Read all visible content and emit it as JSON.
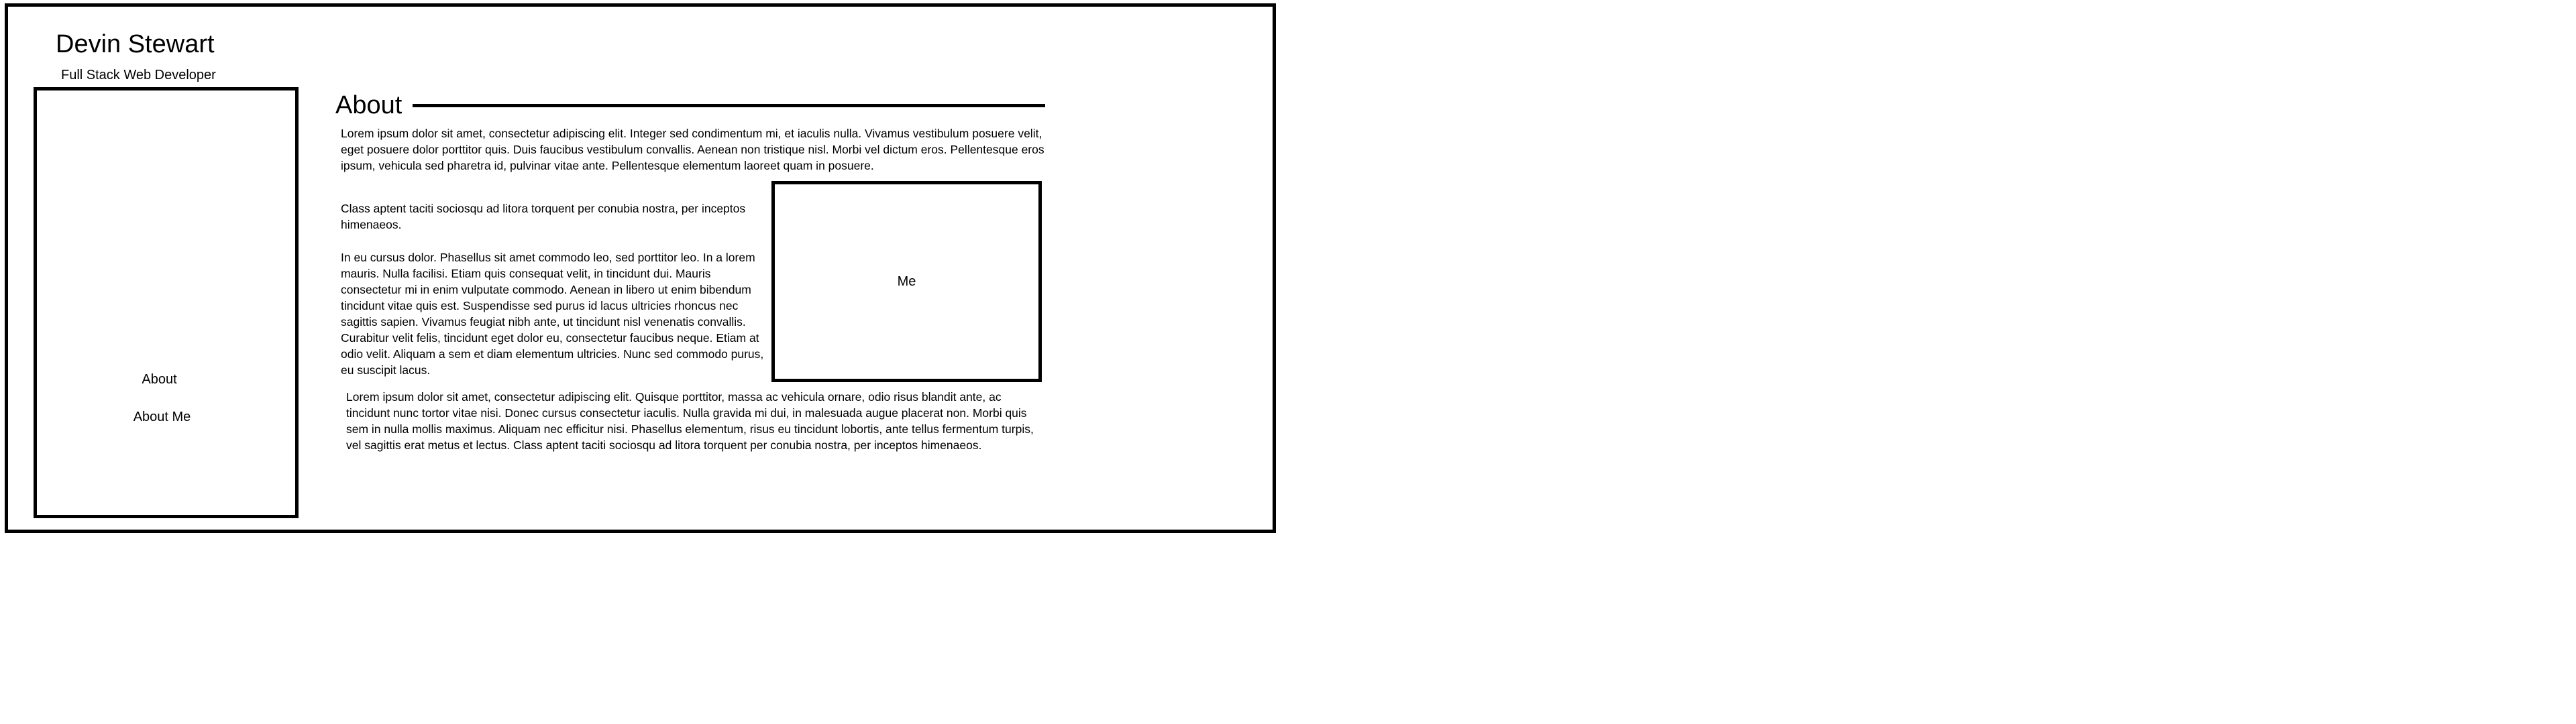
{
  "header": {
    "name": "Devin Stewart",
    "role": "Full Stack Web Developer"
  },
  "sidebar": {
    "items": [
      {
        "label": "About"
      },
      {
        "label": "About Me"
      }
    ]
  },
  "main": {
    "heading": "About",
    "paragraphs": [
      "Lorem ipsum dolor sit amet, consectetur adipiscing elit. Integer sed condimentum mi, et iaculis nulla. Vivamus vestibulum posuere velit, eget posuere dolor porttitor quis. Duis faucibus vestibulum convallis. Aenean non tristique nisl. Morbi vel dictum eros. Pellentesque eros ipsum, vehicula sed pharetra id, pulvinar vitae ante. Pellentesque elementum laoreet quam in posuere.",
      "Class aptent taciti sociosqu ad litora torquent per conubia nostra, per inceptos himenaeos.",
      "In eu cursus dolor. Phasellus sit amet commodo leo, sed porttitor leo. In a lorem mauris. Nulla facilisi. Etiam quis consequat velit, in tincidunt dui. Mauris consectetur mi in enim vulputate commodo. Aenean in libero ut enim bibendum tincidunt vitae quis est. Suspendisse sed purus id lacus ultricies rhoncus nec sagittis sapien. Vivamus feugiat nibh ante, ut tincidunt nisl venenatis convallis. Curabitur velit felis, tincidunt eget dolor eu, consectetur faucibus neque. Etiam at odio velit. Aliquam a sem et diam elementum ultricies. Nunc sed commodo purus, eu suscipit lacus.",
      "Lorem ipsum dolor sit amet, consectetur adipiscing elit. Quisque porttitor, massa ac vehicula ornare, odio risus blandit ante, ac tincidunt nunc tortor vitae nisi. Donec cursus consectetur iaculis. Nulla gravida mi dui, in malesuada augue placerat non. Morbi quis sem in nulla mollis maximus. Aliquam nec efficitur nisi. Phasellus elementum, risus eu tincidunt lobortis, ante tellus fermentum turpis, vel sagittis erat metus et lectus. Class aptent taciti sociosqu ad litora torquent per conubia nostra, per inceptos himenaeos."
    ],
    "image_label": "Me"
  }
}
